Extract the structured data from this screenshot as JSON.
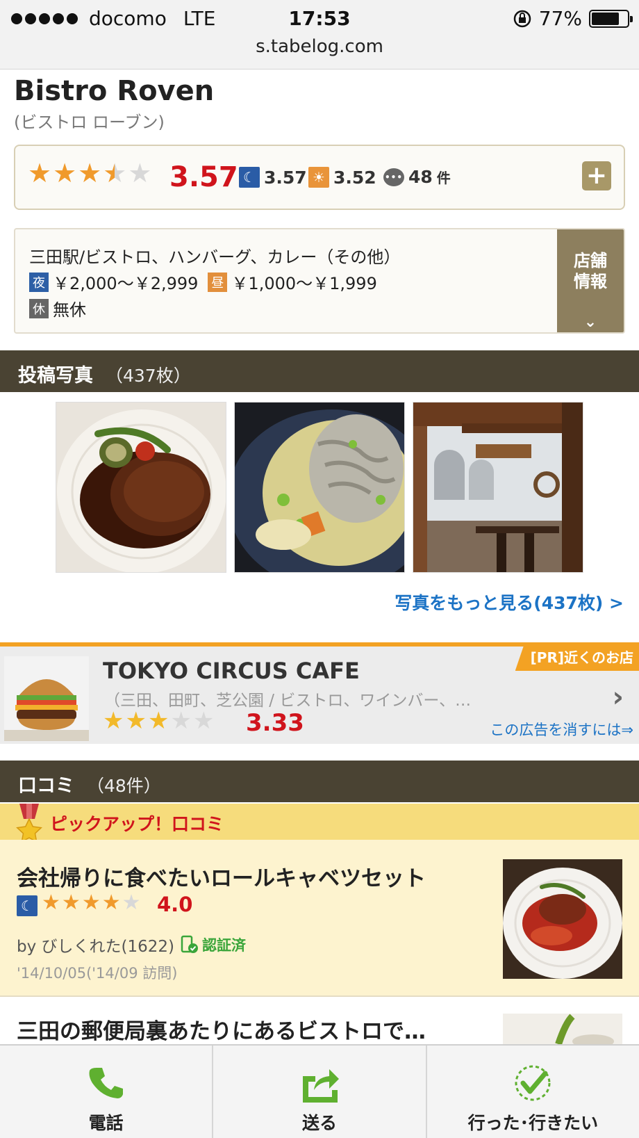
{
  "status_bar": {
    "carrier": "docomo",
    "network": "LTE",
    "time": "17:53",
    "battery": "77%",
    "battery_level": 0.77,
    "url": "s.tabelog.com"
  },
  "restaurant": {
    "name": "Bistro Roven",
    "kana": "(ビストロ ローブン)"
  },
  "rating": {
    "score": "3.57",
    "stars": 3.5,
    "night_score": "3.57",
    "day_score": "3.52",
    "review_count": "48",
    "review_unit": "件"
  },
  "info": {
    "category": "三田駅/ビストロ、ハンバーグ、カレー（その他）",
    "night_tag": "夜",
    "night_price": "￥2,000～￥2,999",
    "day_tag": "昼",
    "day_price": "￥1,000～￥1,999",
    "holiday_tag": "休",
    "holiday": "無休",
    "shop_info_button": "店舗\n情報"
  },
  "photos_section": {
    "title": "投稿写真",
    "count": "（437枚）",
    "more_link": "写真をもっと見る(437枚) >"
  },
  "ad": {
    "pr_label": "[PR]近くのお店",
    "name": "TOKYO CIRCUS CAFE",
    "sub": "（三田、田町、芝公園 / ビストロ、ワインバー、…",
    "score": "3.33",
    "stars": 3,
    "remove_link": "この広告を消すには⇒"
  },
  "reviews_section": {
    "title": "口コミ",
    "count": "（48件）",
    "pickup_label": "ピックアップ！口コミ",
    "items": [
      {
        "title": "会社帰りに食べたいロールキャベツセット",
        "score": "4.0",
        "stars": 4,
        "by": "by びしくれた(1622)",
        "verified": "認証済",
        "date": "'14/10/05('14/09 訪問)"
      },
      {
        "title": "三田の郵便局裏あたりにあるビストロで…"
      }
    ]
  },
  "toolbar": {
    "call": "電話",
    "send": "送る",
    "been": "行った･行きたい"
  },
  "colors": {
    "accent_red": "#d0141c",
    "link_blue": "#1c73c5",
    "header_brown": "#4a4333",
    "pr_orange": "#f3a223"
  }
}
